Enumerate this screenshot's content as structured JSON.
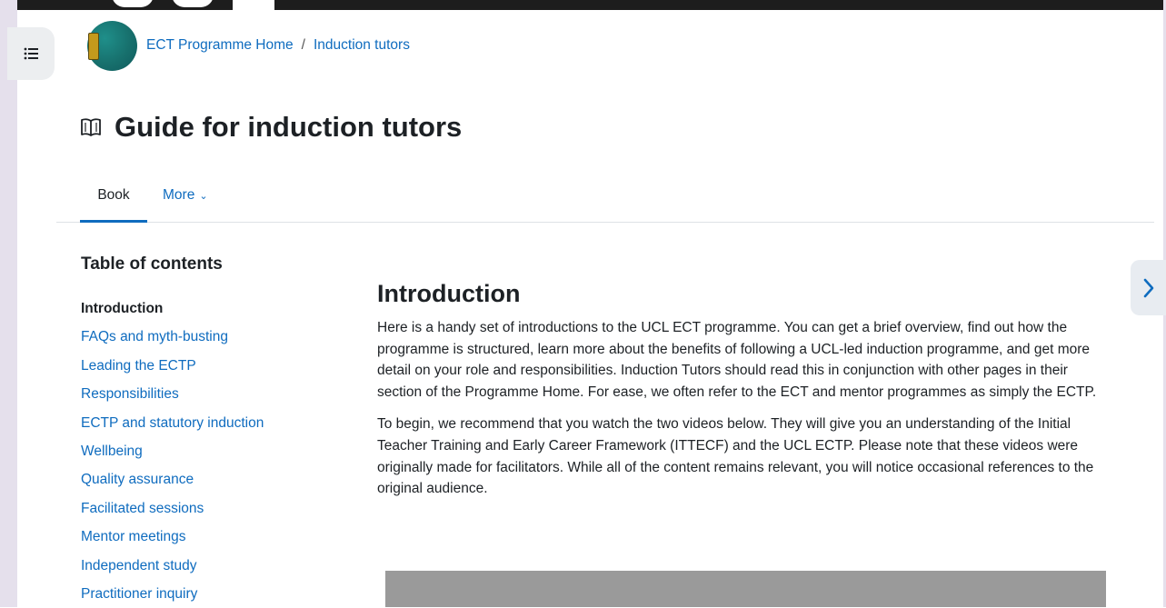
{
  "breadcrumb": {
    "home": "ECT Programme Home",
    "separator": "/",
    "current": "Induction tutors"
  },
  "page": {
    "title": "Guide for induction tutors"
  },
  "tabs": {
    "book": "Book",
    "more": "More",
    "more_caret": "⌄"
  },
  "toc": {
    "heading": "Table of contents",
    "items": [
      "Introduction",
      "FAQs and myth-busting",
      "Leading the ECTP",
      "Responsibilities",
      "ECTP and statutory induction",
      "Wellbeing",
      "Quality assurance",
      "Facilitated sessions",
      "Mentor meetings",
      "Independent study",
      "Practitioner inquiry"
    ]
  },
  "content": {
    "heading": "Introduction",
    "paragraph1": "Here is a handy set of introductions to the UCL ECT programme. You can get a brief overview, find out how the programme is structured, learn more about the benefits of following a UCL-led induction programme, and get more detail on your role and responsibilities. Induction Tutors should read this in conjunction with other pages in their section of the Programme Home. For ease, we often refer to the ECT and mentor programmes as simply the ECTP.",
    "paragraph2": "To begin, we recommend that you watch the two videos below. They will give you an understanding of the Initial Teacher Training and Early Career Framework (ITTECF) and the UCL ECTP. Please note that these videos were originally made for facilitators. While all of the content remains relevant, you will notice occasional references to the original audience."
  },
  "icons": {
    "drawer": "list-icon",
    "title": "book-open-icon",
    "next": "chevron-right-icon"
  },
  "colors": {
    "link": "#0f6cbf",
    "text": "#1d2125",
    "side_strip": "#e5e0ec",
    "top_bar": "#1d1d1d"
  }
}
